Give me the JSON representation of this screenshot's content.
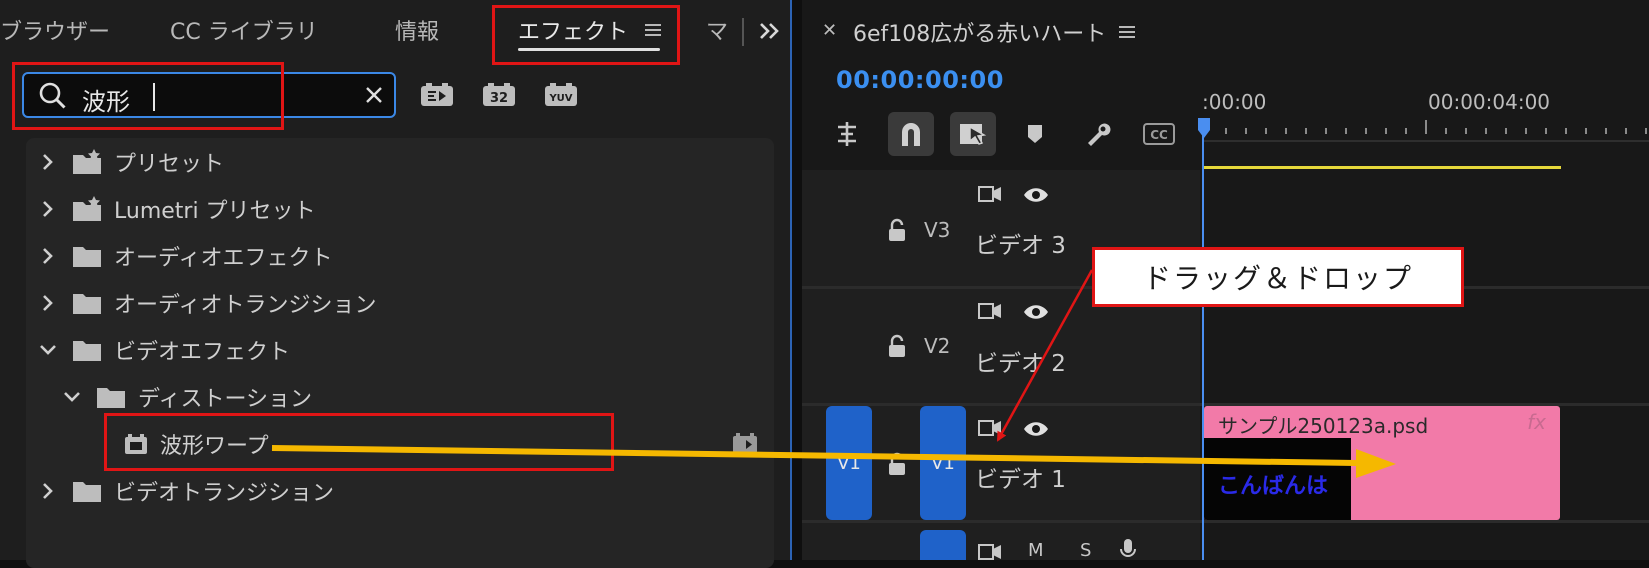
{
  "left_panel": {
    "tabs": [
      {
        "label": "ブラウザー"
      },
      {
        "label": "CC ライブラリ"
      },
      {
        "label": "情報"
      },
      {
        "label": "エフェクト"
      },
      {
        "label": "マ"
      }
    ],
    "search": {
      "value": "波形"
    },
    "tree": [
      {
        "label": "プリセット"
      },
      {
        "label": "Lumetri プリセット"
      },
      {
        "label": "オーディオエフェクト"
      },
      {
        "label": "オーディオトランジション"
      },
      {
        "label": "ビデオエフェクト"
      },
      {
        "label": "ディストーション"
      },
      {
        "label": "波形ワープ"
      },
      {
        "label": "ビデオトランジション"
      }
    ],
    "toolbar_icons": [
      "accelerated-effects-icon",
      "32bit-color-icon",
      "yuv-effects-icon"
    ]
  },
  "timeline": {
    "sequence_title": "6ef108広がる赤いハート",
    "timecode": "00:00:00:00",
    "ruler": [
      ":00:00",
      "00:00:04:00"
    ],
    "tracks": [
      {
        "id": "V3",
        "label": "ビデオ 3"
      },
      {
        "id": "V2",
        "label": "ビデオ 2"
      },
      {
        "id": "V1",
        "label": "ビデオ 1",
        "source": "V1"
      },
      {
        "audio_buttons": [
          "M",
          "S"
        ]
      }
    ],
    "clip": {
      "name": "サンプル250123a.psd",
      "fx": "fx",
      "thumb_text": "こんばんは"
    }
  },
  "annotation": {
    "callout": "ドラッグ＆ドロップ"
  },
  "colors": {
    "accent_blue": "#3b8ff0",
    "highlight_red": "#e01515",
    "arrow_yellow": "#f5b800",
    "clip_pink": "#f27aa8",
    "work_bar": "#e6d83a"
  }
}
